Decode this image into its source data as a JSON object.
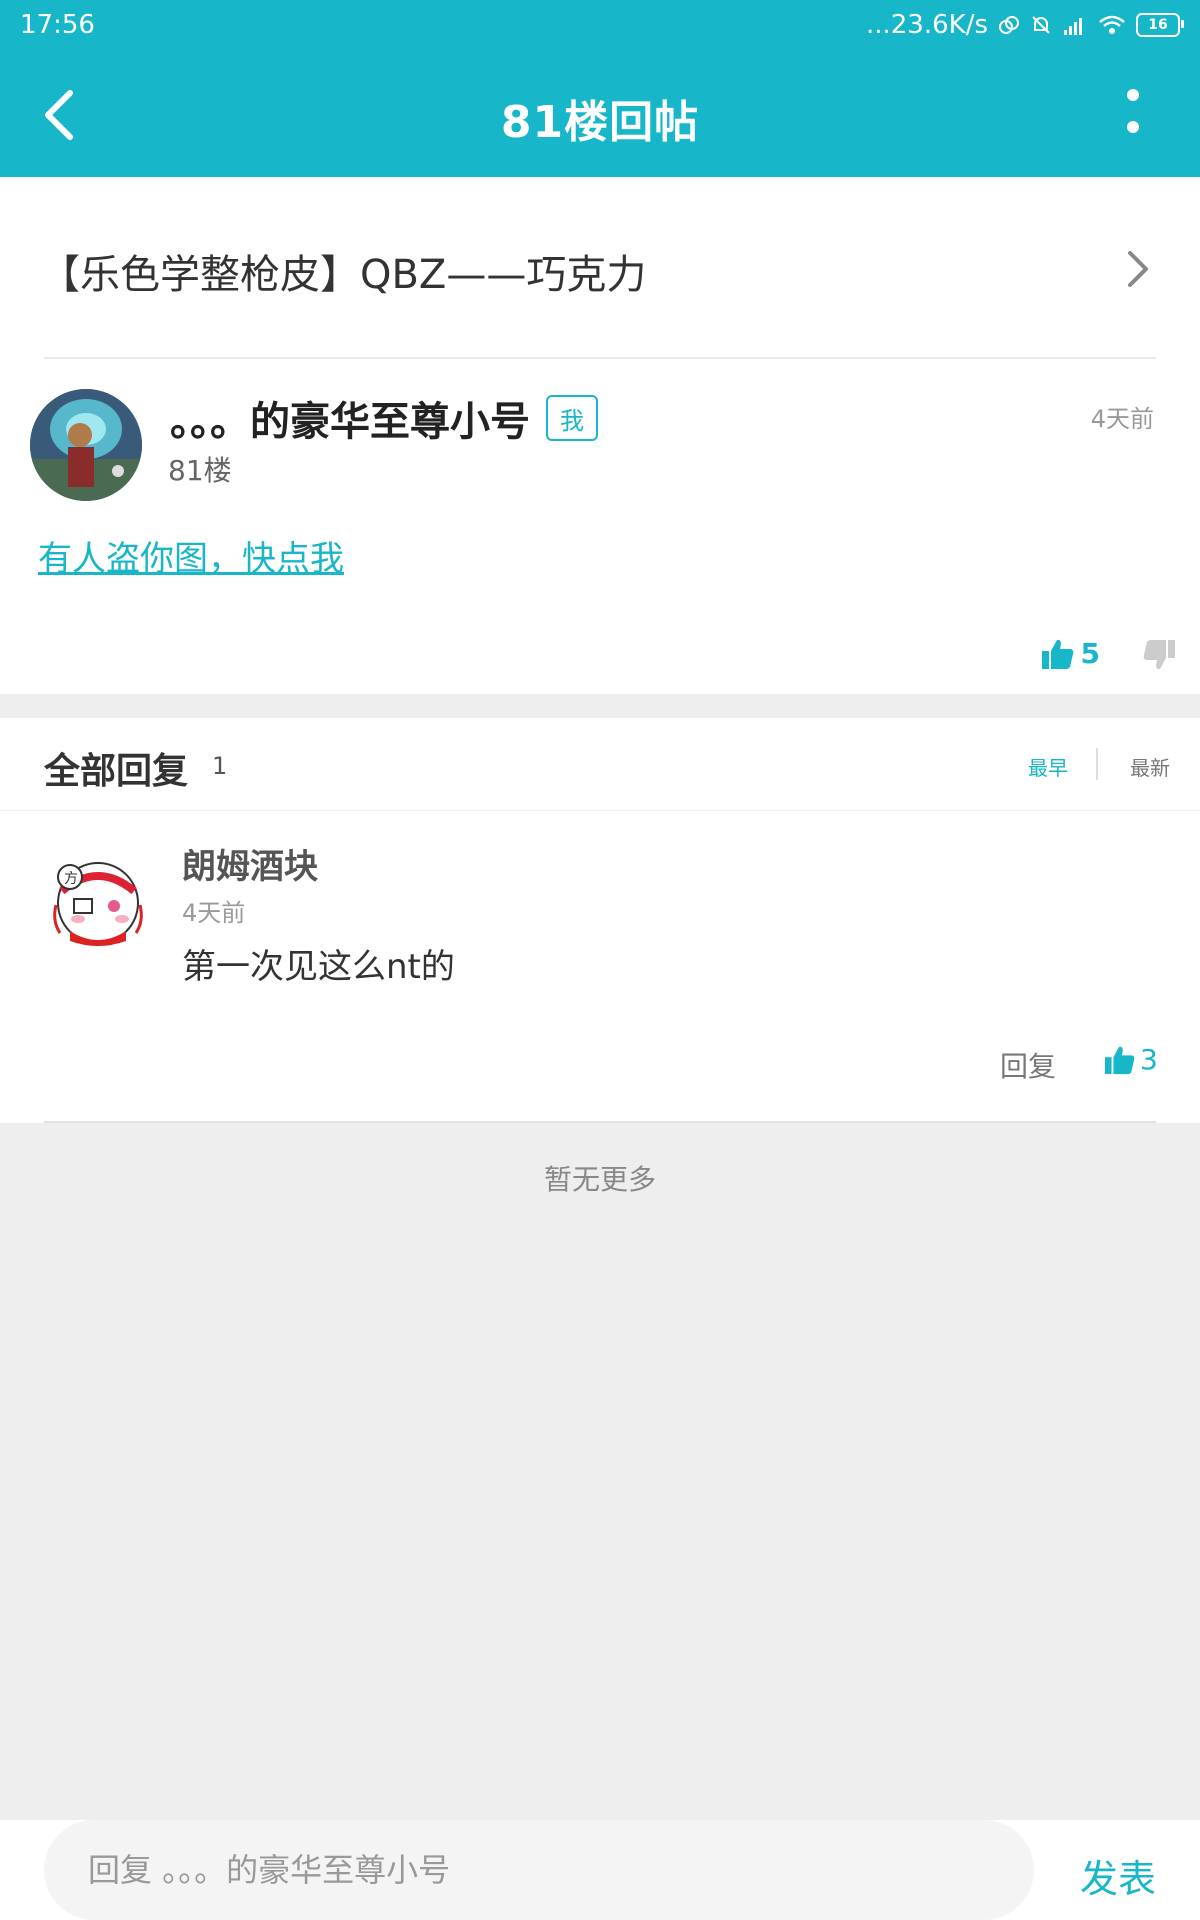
{
  "status_bar": {
    "time": "17:56",
    "network_speed": "...23.6K/s",
    "battery": "16"
  },
  "nav": {
    "title": "81楼回帖"
  },
  "thread": {
    "title": "【乐色学整枪皮】QBZ——巧克力"
  },
  "op_post": {
    "author": "。。。的豪华至尊小号",
    "me_badge": "我",
    "floor": "81楼",
    "time": "4天前",
    "content": "有人盗你图，快点我",
    "likes": "5"
  },
  "replies_section": {
    "title": "全部回复",
    "count": "1",
    "sort_earliest": "最早",
    "sort_latest": "最新"
  },
  "replies": [
    {
      "author": "朗姆酒块",
      "time": "4天前",
      "content": "第一次见这么nt的",
      "reply_label": "回复",
      "likes": "3"
    }
  ],
  "no_more_text": "暂无更多",
  "bottom_bar": {
    "placeholder": "回复 。。。的豪华至尊小号",
    "send_label": "发表"
  },
  "colors": {
    "accent": "#17b6c8",
    "background": "#eeeeee"
  }
}
